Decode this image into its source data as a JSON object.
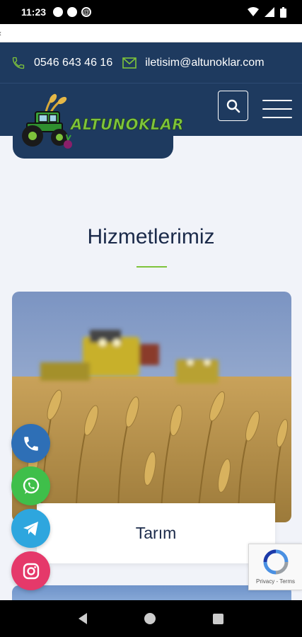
{
  "status_bar": {
    "time": "11:23"
  },
  "header": {
    "phone": "0546 643 46 16",
    "email": "iletisim@altunoklar.com",
    "logo_text": "ALTUNOKLAR"
  },
  "main": {
    "section_title": "Hizmetlerimiz",
    "cards": [
      {
        "label": "Tarım"
      }
    ]
  },
  "recaptcha": {
    "links": "Privacy - Terms"
  },
  "colors": {
    "header_bg": "#1e3a5f",
    "accent_green": "#7ec33b",
    "title_navy": "#1b2a4a",
    "phone_fab": "#2e6fb6",
    "whatsapp_fab": "#3fbf4a",
    "telegram_fab": "#2ea6de",
    "instagram_fab": "#e5396a"
  },
  "icons": {
    "contact_phone": "phone-icon",
    "contact_email": "mail-icon",
    "search": "search-icon",
    "menu": "hamburger-icon",
    "fab_phone": "phone-icon",
    "fab_whatsapp": "whatsapp-icon",
    "fab_telegram": "telegram-icon",
    "fab_instagram": "instagram-icon"
  }
}
